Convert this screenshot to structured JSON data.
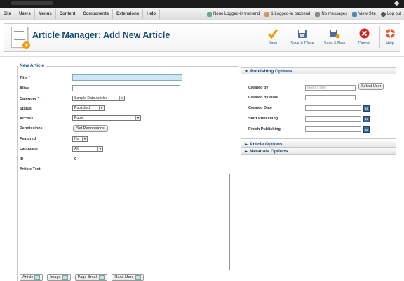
{
  "menu": [
    "Site",
    "Users",
    "Menus",
    "Content",
    "Components",
    "Extensions",
    "Help"
  ],
  "status": {
    "logged_frontend": "None Logged-in frontend",
    "logged_backend": "1 Logged-in backend",
    "messages": "No messages",
    "view_site": "View Site",
    "log_out": "Log out"
  },
  "toolbar": {
    "title": "Article Manager: Add New Article",
    "save": "Save",
    "save_close": "Save & Close",
    "save_new": "Save & New",
    "cancel": "Cancel",
    "help": "Help"
  },
  "form": {
    "legend": "New Article",
    "title_label": "Title",
    "required_mark": "*",
    "alias_label": "Alias",
    "category_label": "Category",
    "category_value": "Sample Data-Articles",
    "status_label": "Status",
    "status_value": "Published",
    "access_label": "Access",
    "access_value": "Public",
    "permissions_label": "Permissions",
    "permissions_button": "Set Permissions",
    "featured_label": "Featured",
    "featured_value": "No",
    "language_label": "Language",
    "language_value": "All",
    "id_label": "ID",
    "id_value": "0",
    "article_text_label": "Article Text",
    "editor_buttons": [
      "Article",
      "Image",
      "Page Break",
      "Read More"
    ]
  },
  "panel": {
    "publishing_title": "Publishing Options",
    "created_by_label": "Created by",
    "created_by_placeholder": "Select a User",
    "select_user_button": "Select User",
    "created_by_alias_label": "Created by alias",
    "created_date_label": "Created Date",
    "start_publishing_label": "Start Publishing",
    "finish_publishing_label": "Finish Publishing",
    "calendar_icon_text": "23",
    "article_options_title": "Article Options",
    "metadata_options_title": "Metadata Options"
  },
  "colors": {
    "accent": "#164a7a",
    "title_highlight": "#cfe6f7",
    "save_icon": "#e8a000",
    "cancel_icon": "#d42020"
  }
}
